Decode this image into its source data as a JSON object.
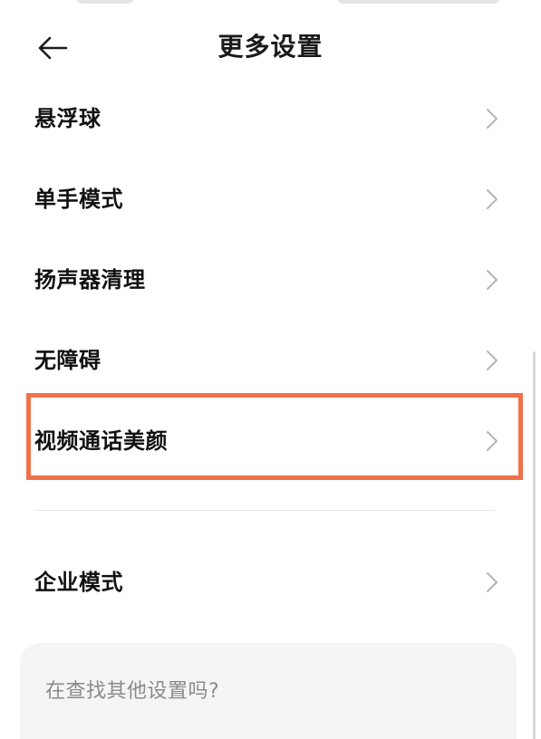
{
  "header": {
    "title": "更多设置",
    "back_icon": "arrow-left-icon"
  },
  "menu": {
    "items": [
      {
        "label": "悬浮球",
        "icon": "chevron-right-icon"
      },
      {
        "label": "单手模式",
        "icon": "chevron-right-icon"
      },
      {
        "label": "扬声器清理",
        "icon": "chevron-right-icon"
      },
      {
        "label": "无障碍",
        "icon": "chevron-right-icon"
      },
      {
        "label": "视频通话美颜",
        "icon": "chevron-right-icon",
        "highlighted": true
      },
      {
        "label": "企业模式",
        "icon": "chevron-right-icon"
      }
    ]
  },
  "search_card": {
    "prompt": "在查找其他设置吗?"
  },
  "colors": {
    "highlight": "#f0714a",
    "text_primary": "#111111",
    "text_secondary": "#8a8a8a",
    "chevron": "#b5b5b5",
    "card_bg": "#f5f5f5"
  }
}
